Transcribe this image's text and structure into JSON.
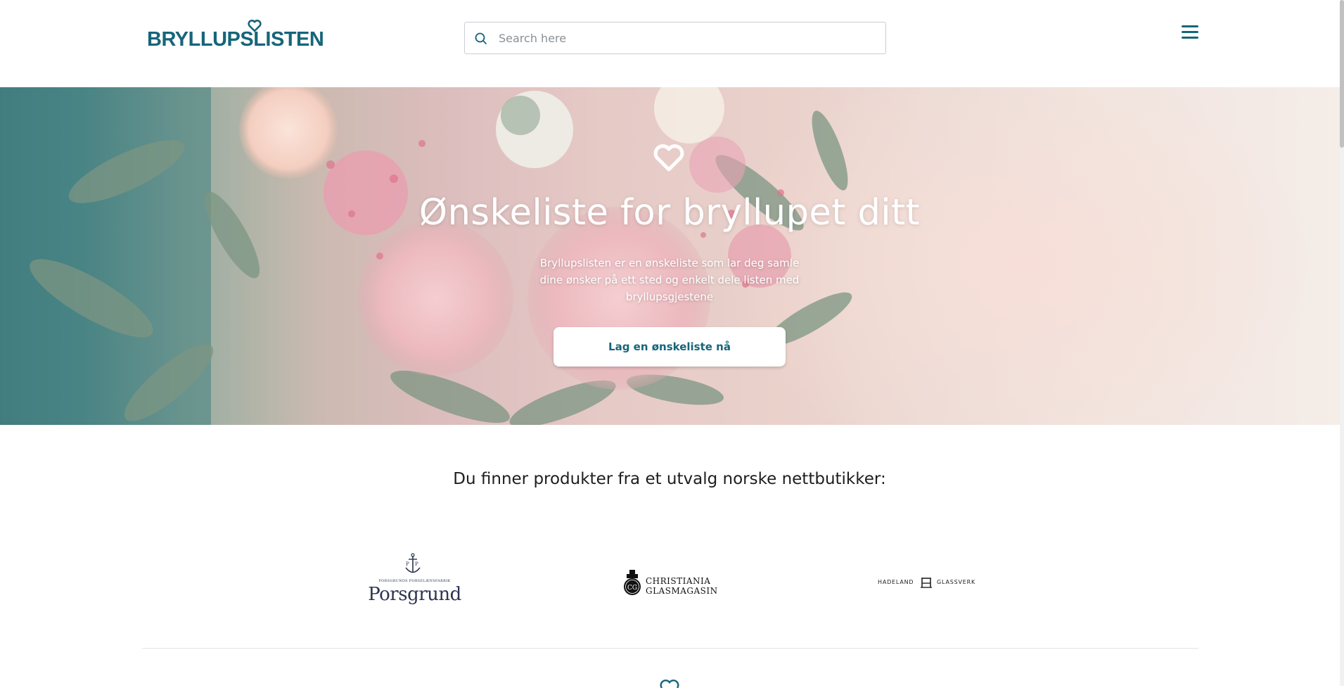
{
  "header": {
    "logo_text": "BRYLLUPSLISTEN",
    "search": {
      "placeholder": "Search here",
      "value": ""
    },
    "menu_icon": "hamburger-menu-icon"
  },
  "hero": {
    "icon": "heart-icon",
    "title": "Ønskeliste for bryllupet ditt",
    "description": "Bryllupslisten er en ønskeliste som lar deg samle dine ønsker på ett sted og enkelt dele listen med bryllupsgjestene",
    "cta_label": "Lag en ønskeliste nå"
  },
  "stores": {
    "heading": "Du finner produkter fra et utvalg norske nettbutikker:",
    "items": [
      {
        "name": "Porsgrund",
        "small_text": "PORSGRUNDS PORSELÆNSFABRIK",
        "big_text": "Porsgrund"
      },
      {
        "name": "Christiania Glasmagasin",
        "line1": "CHRISTIANIA",
        "line2": "GLASMAGASIN"
      },
      {
        "name": "Hadeland Glassverk",
        "left_text": "HADELAND",
        "right_text": "GLASSVERK"
      }
    ]
  },
  "colors": {
    "brand": "#16657a",
    "text_dark": "#1e1e1e",
    "border": "#c9cdd2"
  }
}
